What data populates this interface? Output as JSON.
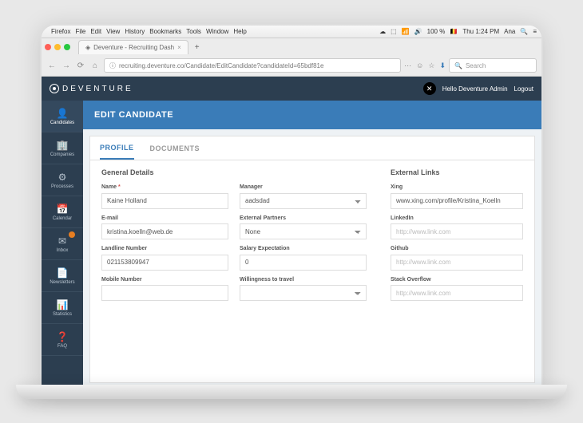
{
  "menubar": {
    "app": "Firefox",
    "items": [
      "File",
      "Edit",
      "View",
      "History",
      "Bookmarks",
      "Tools",
      "Window",
      "Help"
    ],
    "battery": "100 %",
    "time": "Thu 1:24 PM",
    "user": "Ana"
  },
  "browser": {
    "tab_title": "Deventure - Recruiting Dash",
    "url": "recruiting.deventure.co/Candidate/EditCandidate?candidateId=65bdf81e",
    "search_placeholder": "Search"
  },
  "header": {
    "brand": "DEVENTURE",
    "greeting": "Hello Deventure Admin",
    "logout": "Logout"
  },
  "sidebar": {
    "items": [
      {
        "label": "Candidates",
        "icon": "👤"
      },
      {
        "label": "Companies",
        "icon": "🏢"
      },
      {
        "label": "Processes",
        "icon": "⚙"
      },
      {
        "label": "Calendar",
        "icon": "📅"
      },
      {
        "label": "Inbox",
        "icon": "✉"
      },
      {
        "label": "Newsletters",
        "icon": "📄"
      },
      {
        "label": "Statistics",
        "icon": "📊"
      },
      {
        "label": "FAQ",
        "icon": "❓"
      }
    ]
  },
  "page": {
    "title": "EDIT CANDIDATE",
    "tabs": {
      "profile": "PROFILE",
      "documents": "DOCUMENTS"
    }
  },
  "form": {
    "sections": {
      "general": "General Details",
      "external": "External Links"
    },
    "labels": {
      "name": "Name",
      "manager": "Manager",
      "email": "E-mail",
      "external_partners": "External Partners",
      "landline": "Landline Number",
      "salary": "Salary Expectation",
      "mobile": "Mobile Number",
      "willingness": "Willingness to travel",
      "xing": "Xing",
      "linkedin": "LinkedIn",
      "github": "Github",
      "stackoverflow": "Stack Overflow"
    },
    "values": {
      "name": "Kaine Holland",
      "manager": "aadsdad",
      "email": "kristina.koelln@web.de",
      "external_partners": "None",
      "landline": "021153809947",
      "salary": "0",
      "xing": "www.xing.com/profile/Kristina_Koelln"
    },
    "placeholders": {
      "link": "http://www.link.com"
    }
  }
}
